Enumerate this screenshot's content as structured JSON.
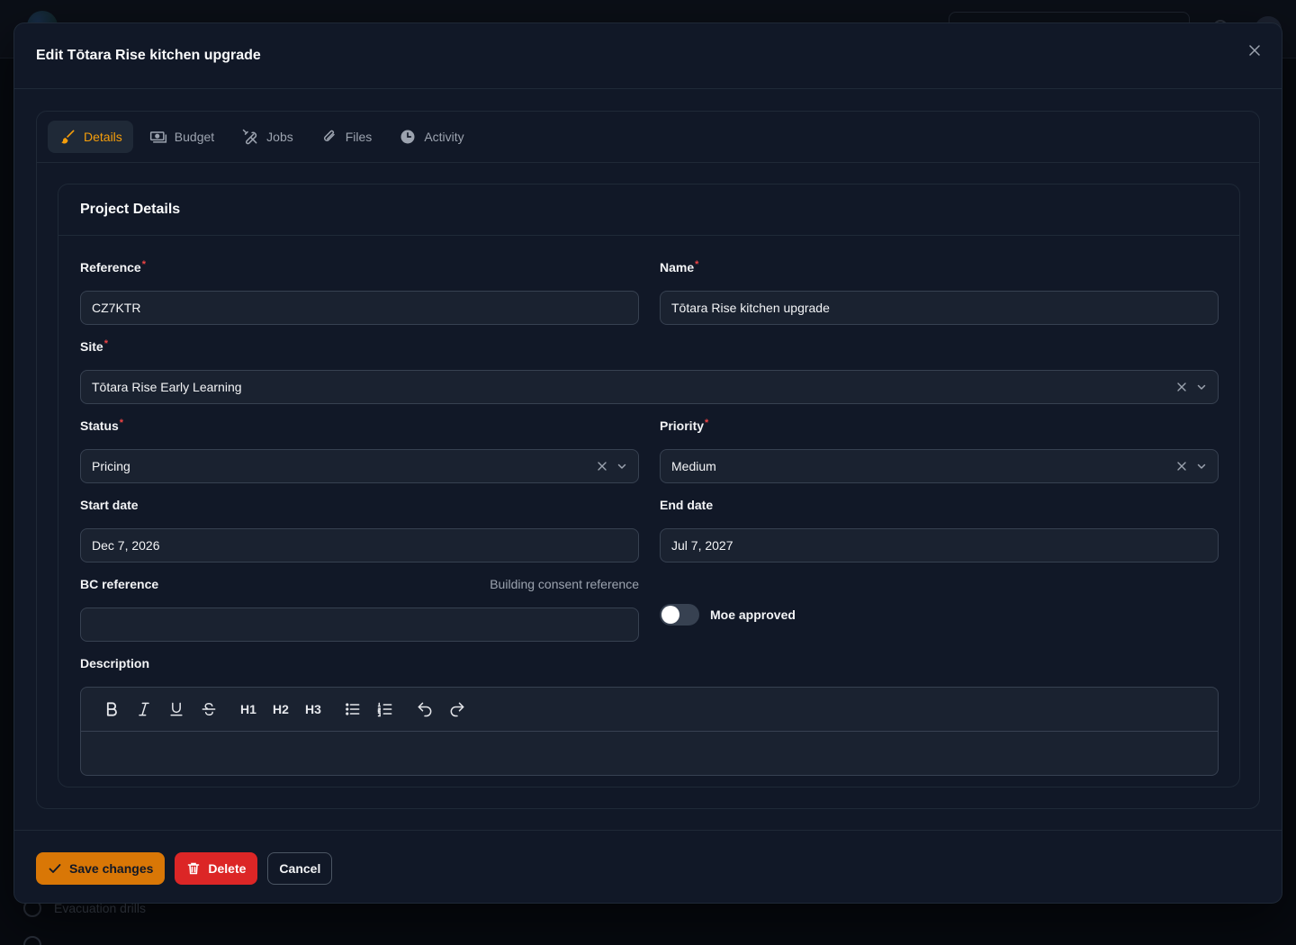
{
  "modal": {
    "title": "Edit Tōtara Rise kitchen upgrade"
  },
  "tabs": [
    {
      "label": "Details",
      "icon": "paintbrush-icon",
      "active": true
    },
    {
      "label": "Budget",
      "icon": "banknotes-icon",
      "active": false
    },
    {
      "label": "Jobs",
      "icon": "wrench-screwdriver-icon",
      "active": false
    },
    {
      "label": "Files",
      "icon": "paperclip-icon",
      "active": false
    },
    {
      "label": "Activity",
      "icon": "clock-icon",
      "active": false
    }
  ],
  "section": {
    "title": "Project Details"
  },
  "fields": {
    "reference": {
      "label": "Reference",
      "value": "CZ7KTR",
      "required": "*"
    },
    "name": {
      "label": "Name",
      "value": "Tōtara Rise kitchen upgrade",
      "required": "*"
    },
    "site": {
      "label": "Site",
      "value": "Tōtara Rise Early Learning",
      "required": "*"
    },
    "status": {
      "label": "Status",
      "value": "Pricing",
      "required": "*"
    },
    "priority": {
      "label": "Priority",
      "value": "Medium",
      "required": "*"
    },
    "start_date": {
      "label": "Start date",
      "value": "Dec 7, 2026"
    },
    "end_date": {
      "label": "End date",
      "value": "Jul 7, 2027"
    },
    "bc_reference": {
      "label": "BC reference",
      "hint": "Building consent reference",
      "value": ""
    },
    "moe_approved": {
      "label": "Moe approved",
      "checked": false
    },
    "description": {
      "label": "Description",
      "value": ""
    }
  },
  "editor_toolbar": {
    "h1": "H1",
    "h2": "H2",
    "h3": "H3"
  },
  "footer": {
    "save_label": "Save changes",
    "delete_label": "Delete",
    "cancel_label": "Cancel"
  },
  "background": {
    "nav_item": "Evacuation drills"
  },
  "colors": {
    "accent": "#f59e0b",
    "primary_button": "#d97706",
    "danger": "#dc2626",
    "required_mark": "#ef4444"
  }
}
